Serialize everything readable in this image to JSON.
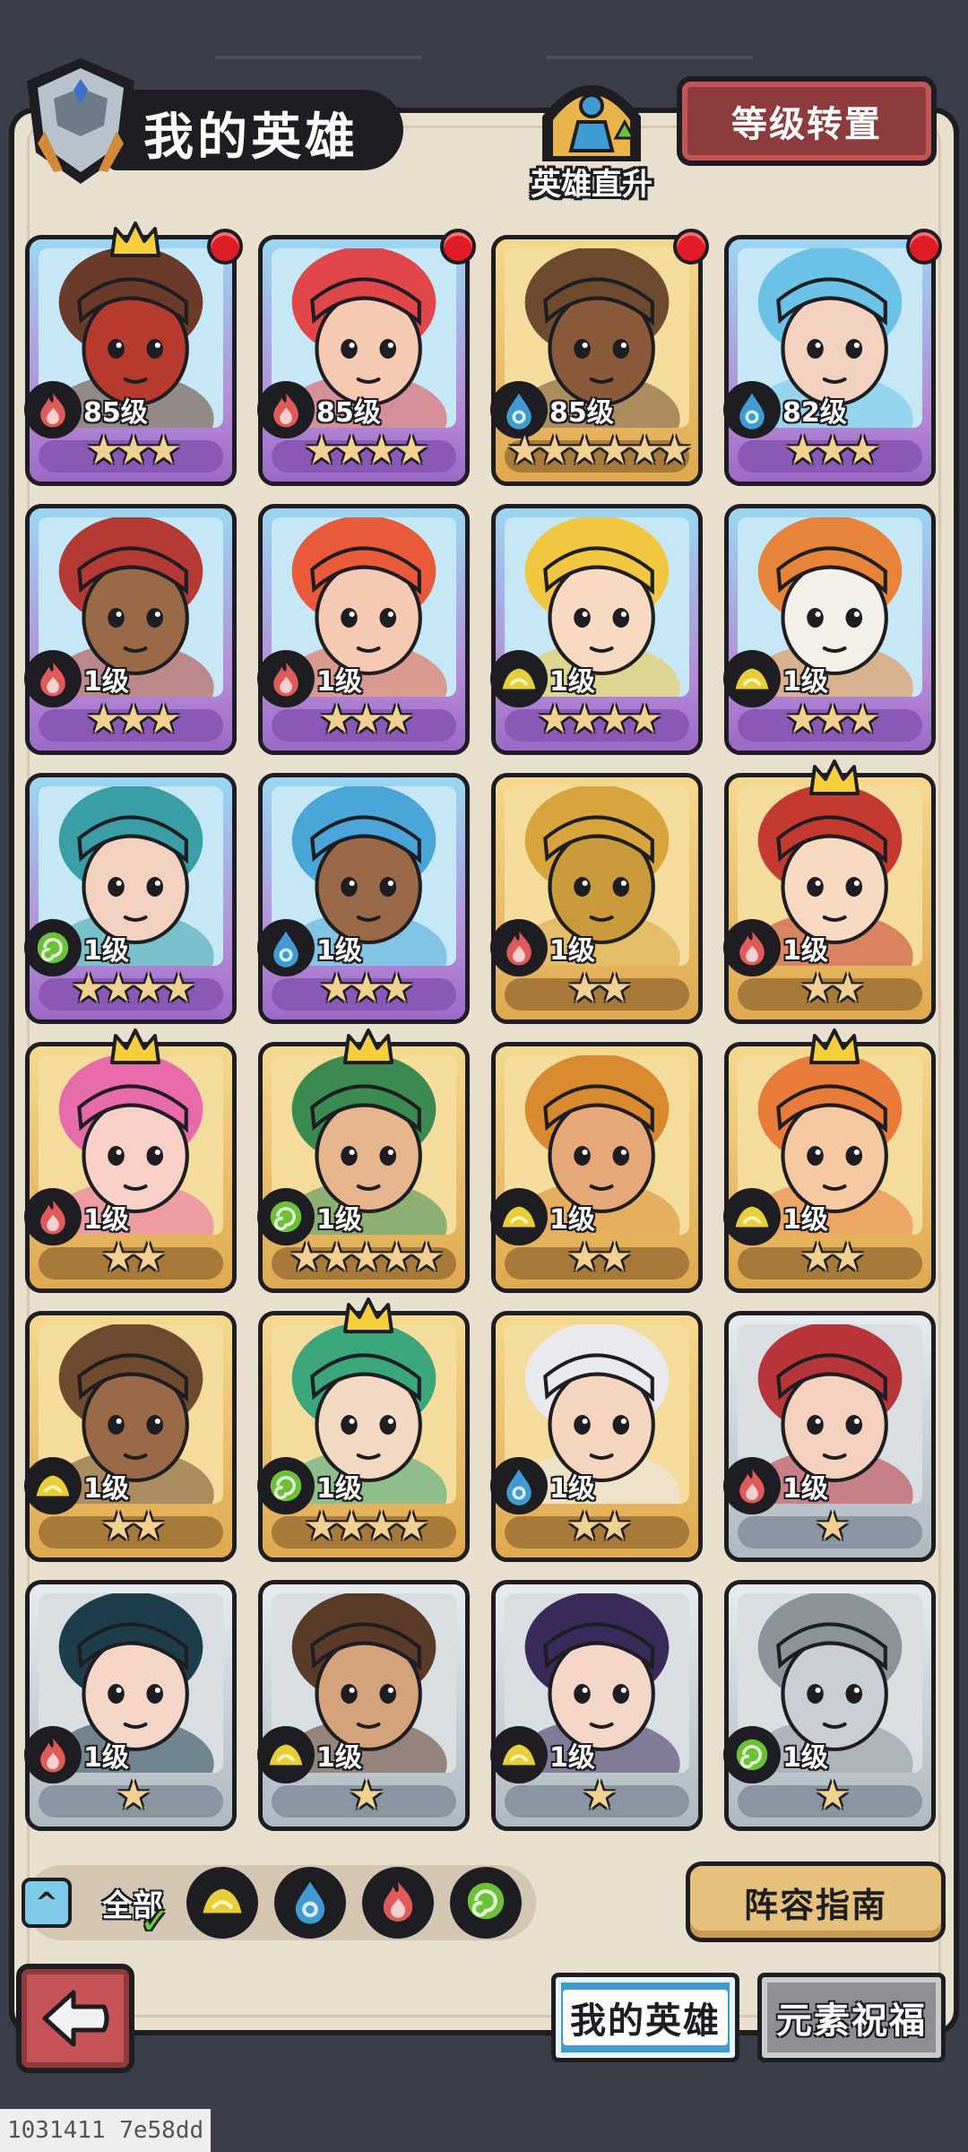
{
  "header": {
    "title": "我的英雄",
    "growth_label": "英雄直升",
    "reset_label": "等级转置"
  },
  "heroes": [
    {
      "level": "85级",
      "element": "fire",
      "stars": 3,
      "tier": "purple",
      "crown": true,
      "red_dot": true,
      "skin": "#b73a2f",
      "hair": "#6a3b2a"
    },
    {
      "level": "85级",
      "element": "fire",
      "stars": 4,
      "tier": "purple",
      "crown": false,
      "red_dot": true,
      "skin": "#f6c9b2",
      "hair": "#e0464a"
    },
    {
      "level": "85级",
      "element": "water",
      "stars": 6,
      "tier": "gold",
      "crown": false,
      "red_dot": true,
      "skin": "#8a5a3a",
      "hair": "#6e4a2e"
    },
    {
      "level": "82级",
      "element": "water",
      "stars": 3,
      "tier": "purple",
      "crown": false,
      "red_dot": true,
      "skin": "#f3d1c0",
      "hair": "#6cc2e6"
    },
    {
      "level": "1级",
      "element": "fire",
      "stars": 3,
      "tier": "purple",
      "crown": false,
      "red_dot": false,
      "skin": "#9a6a48",
      "hair": "#b43a33"
    },
    {
      "level": "1级",
      "element": "fire",
      "stars": 3,
      "tier": "purple",
      "crown": false,
      "red_dot": false,
      "skin": "#f6c9b2",
      "hair": "#e85a3a"
    },
    {
      "level": "1级",
      "element": "earth",
      "stars": 4,
      "tier": "purple",
      "crown": false,
      "red_dot": false,
      "skin": "#f8d9c2",
      "hair": "#f1c742"
    },
    {
      "level": "1级",
      "element": "earth",
      "stars": 3,
      "tier": "purple",
      "crown": false,
      "red_dot": false,
      "skin": "#f3f0e8",
      "hair": "#e8843a"
    },
    {
      "level": "1级",
      "element": "wind",
      "stars": 4,
      "tier": "purple",
      "crown": false,
      "red_dot": false,
      "skin": "#f3d1c0",
      "hair": "#3a9ea6"
    },
    {
      "level": "1级",
      "element": "water",
      "stars": 3,
      "tier": "purple",
      "crown": false,
      "red_dot": false,
      "skin": "#9a6a48",
      "hair": "#4aa6d8"
    },
    {
      "level": "1级",
      "element": "fire",
      "stars": 2,
      "tier": "gold",
      "crown": false,
      "red_dot": false,
      "skin": "#c99a3a",
      "hair": "#d7a43e"
    },
    {
      "level": "1级",
      "element": "fire",
      "stars": 2,
      "tier": "gold",
      "crown": true,
      "red_dot": false,
      "skin": "#f8d9c2",
      "hair": "#c43a30"
    },
    {
      "level": "1级",
      "element": "fire",
      "stars": 2,
      "tier": "gold",
      "crown": true,
      "red_dot": false,
      "skin": "#f8d0c8",
      "hair": "#e86aa8"
    },
    {
      "level": "1级",
      "element": "wind",
      "stars": 5,
      "tier": "gold",
      "crown": true,
      "red_dot": false,
      "skin": "#e6b58e",
      "hair": "#3b8a52"
    },
    {
      "level": "1级",
      "element": "earth",
      "stars": 2,
      "tier": "gold",
      "crown": false,
      "red_dot": false,
      "skin": "#e6a878",
      "hair": "#d98a2e"
    },
    {
      "level": "1级",
      "element": "earth",
      "stars": 2,
      "tier": "gold",
      "crown": true,
      "red_dot": false,
      "skin": "#f6c9a2",
      "hair": "#e87a3a"
    },
    {
      "level": "1级",
      "element": "earth",
      "stars": 2,
      "tier": "gold",
      "crown": false,
      "red_dot": false,
      "skin": "#9a6a48",
      "hair": "#6e4a2e"
    },
    {
      "level": "1级",
      "element": "wind",
      "stars": 4,
      "tier": "gold",
      "crown": true,
      "red_dot": false,
      "skin": "#f3d8c4",
      "hair": "#3aa67a"
    },
    {
      "level": "1级",
      "element": "water",
      "stars": 2,
      "tier": "gold",
      "crown": false,
      "red_dot": false,
      "skin": "#f6d5c0",
      "hair": "#e9e9ee"
    },
    {
      "level": "1级",
      "element": "fire",
      "stars": 1,
      "tier": "silver",
      "crown": false,
      "red_dot": false,
      "skin": "#f6d0be",
      "hair": "#b8353a"
    },
    {
      "level": "1级",
      "element": "fire",
      "stars": 1,
      "tier": "silver",
      "crown": false,
      "red_dot": false,
      "skin": "#f3d6c8",
      "hair": "#1e3d4a"
    },
    {
      "level": "1级",
      "element": "earth",
      "stars": 1,
      "tier": "silver",
      "crown": false,
      "red_dot": false,
      "skin": "#d4a37c",
      "hair": "#5a3a28"
    },
    {
      "level": "1级",
      "element": "earth",
      "stars": 1,
      "tier": "silver",
      "crown": false,
      "red_dot": false,
      "skin": "#f3d6c8",
      "hair": "#3a2a5a"
    },
    {
      "level": "1级",
      "element": "wind",
      "stars": 1,
      "tier": "silver",
      "crown": false,
      "red_dot": false,
      "skin": "#c9ced4",
      "hair": "#8a929a"
    }
  ],
  "filters": {
    "all_label": "全部",
    "elements": [
      "earth",
      "water",
      "fire",
      "wind"
    ]
  },
  "guide_label": "阵容指南",
  "tabs": {
    "my_heroes": "我的英雄",
    "blessing": "元素祝福"
  },
  "footer_id": "1031411 7e58dd",
  "colors": {
    "fire": "#e05a5a",
    "water": "#3f9bd1",
    "earth": "#e8cf3a",
    "wind": "#6bc13a"
  }
}
